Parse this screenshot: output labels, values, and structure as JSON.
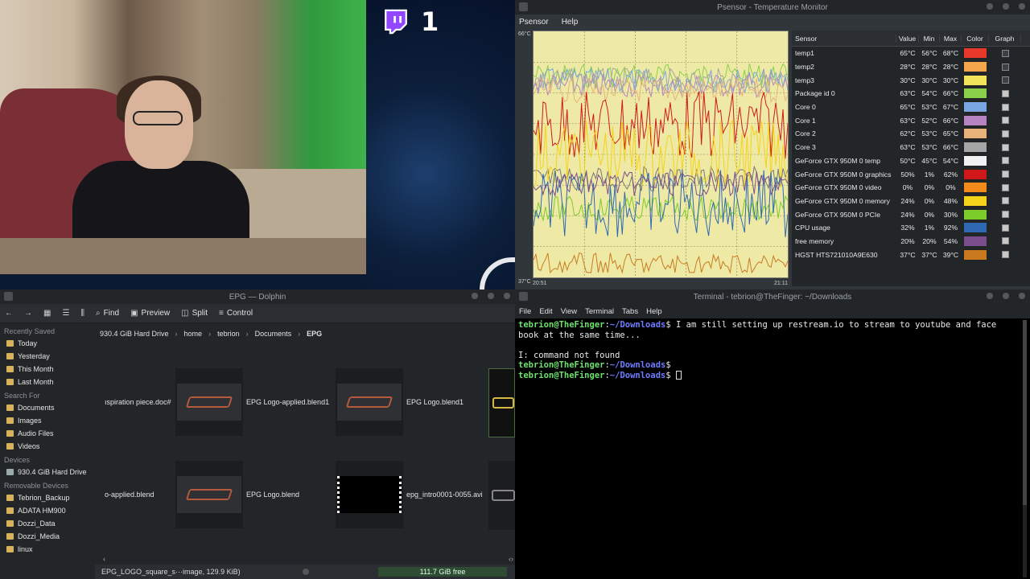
{
  "stream": {
    "twitch_count": "1"
  },
  "psensor": {
    "title": "Psensor - Temperature Monitor",
    "menu": [
      "Psensor",
      "Help"
    ],
    "graph": {
      "y_max": "66°C",
      "y_min": "37°C",
      "x_start": "20:51",
      "x_end": "21:11"
    },
    "columns": [
      "Sensor",
      "Value",
      "Min",
      "Max",
      "Color",
      "Graph"
    ],
    "rows": [
      {
        "name": "temp1",
        "value": "65°C",
        "min": "56°C",
        "max": "68°C",
        "color": "#e8372b",
        "graph": false
      },
      {
        "name": "temp2",
        "value": "28°C",
        "min": "28°C",
        "max": "28°C",
        "color": "#f3a64c",
        "graph": false
      },
      {
        "name": "temp3",
        "value": "30°C",
        "min": "30°C",
        "max": "30°C",
        "color": "#f1e35a",
        "graph": false
      },
      {
        "name": "Package id 0",
        "value": "63°C",
        "min": "54°C",
        "max": "66°C",
        "color": "#8bd04a",
        "graph": true
      },
      {
        "name": "Core 0",
        "value": "65°C",
        "min": "53°C",
        "max": "67°C",
        "color": "#79a6e0",
        "graph": true
      },
      {
        "name": "Core 1",
        "value": "63°C",
        "min": "52°C",
        "max": "66°C",
        "color": "#b784c2",
        "graph": true
      },
      {
        "name": "Core 2",
        "value": "62°C",
        "min": "53°C",
        "max": "65°C",
        "color": "#e8b37a",
        "graph": true
      },
      {
        "name": "Core 3",
        "value": "63°C",
        "min": "53°C",
        "max": "66°C",
        "color": "#a5a5a5",
        "graph": true
      },
      {
        "name": "GeForce GTX 950M 0 temp",
        "value": "50°C",
        "min": "45°C",
        "max": "54°C",
        "color": "#f2f2f2",
        "graph": true
      },
      {
        "name": "GeForce GTX 950M 0 graphics",
        "value": "50%",
        "min": "1%",
        "max": "62%",
        "color": "#d11818",
        "graph": true
      },
      {
        "name": "GeForce GTX 950M 0 video",
        "value": "0%",
        "min": "0%",
        "max": "0%",
        "color": "#f48a1a",
        "graph": true
      },
      {
        "name": "GeForce GTX 950M 0 memory",
        "value": "24%",
        "min": "0%",
        "max": "48%",
        "color": "#f4d21a",
        "graph": true
      },
      {
        "name": "GeForce GTX 950M 0 PCIe",
        "value": "24%",
        "min": "0%",
        "max": "30%",
        "color": "#7ccc2a",
        "graph": true
      },
      {
        "name": "CPU usage",
        "value": "32%",
        "min": "1%",
        "max": "92%",
        "color": "#2f69b3",
        "graph": true
      },
      {
        "name": "free memory",
        "value": "20%",
        "min": "20%",
        "max": "54%",
        "color": "#7a4e8c",
        "graph": true
      },
      {
        "name": "HGST HTS721010A9E630",
        "value": "37°C",
        "min": "37°C",
        "max": "39°C",
        "color": "#c97a1f",
        "graph": true
      }
    ]
  },
  "dolphin": {
    "title": "EPG — Dolphin",
    "toolbar": [
      "Find",
      "Preview",
      "Split",
      "Control"
    ],
    "sidebar": {
      "recently_saved_title": "Recently Saved",
      "recently_saved": [
        "Today",
        "Yesterday",
        "This Month",
        "Last Month"
      ],
      "search_for_title": "Search For",
      "search_for": [
        "Documents",
        "Images",
        "Audio Files",
        "Videos"
      ],
      "devices_title": "Devices",
      "devices": [
        "930.4 GiB Hard Drive"
      ],
      "removable_title": "Removable Devices",
      "removable": [
        "Tebrion_Backup",
        "ADATA HM900",
        "Dozzi_Data",
        "Dozzi_Media",
        "linux"
      ]
    },
    "breadcrumb": [
      "930.4 GiB Hard Drive",
      "home",
      "tebrion",
      "Documents",
      "EPG"
    ],
    "files": [
      {
        "name": "ıspiration piece.doc#",
        "kind": "text"
      },
      {
        "name": "EPG Logo-applied.blend1",
        "kind": "logo"
      },
      {
        "name": "EPG Logo.blend1",
        "kind": "logo"
      },
      {
        "name": "o-applied.blend",
        "kind": "text"
      },
      {
        "name": "EPG Logo.blend",
        "kind": "logo"
      },
      {
        "name": "epg_intro0001-0055.avi",
        "kind": "video"
      }
    ],
    "status": "EPG_LOGO_square_s···image, 129.9 KiB)",
    "free_space": "111.7 GiB free"
  },
  "terminal": {
    "title": "Terminal - tebrion@TheFinger: ~/Downloads",
    "menu": [
      "File",
      "Edit",
      "View",
      "Terminal",
      "Tabs",
      "Help"
    ],
    "prompt_user": "tebrion@TheFinger",
    "prompt_path": "~/Downloads",
    "line1_cmd": " I am still setting up restream.io to stream to youtube and face",
    "line1_wrap": "book at the same time...",
    "error": "I: command not found"
  }
}
